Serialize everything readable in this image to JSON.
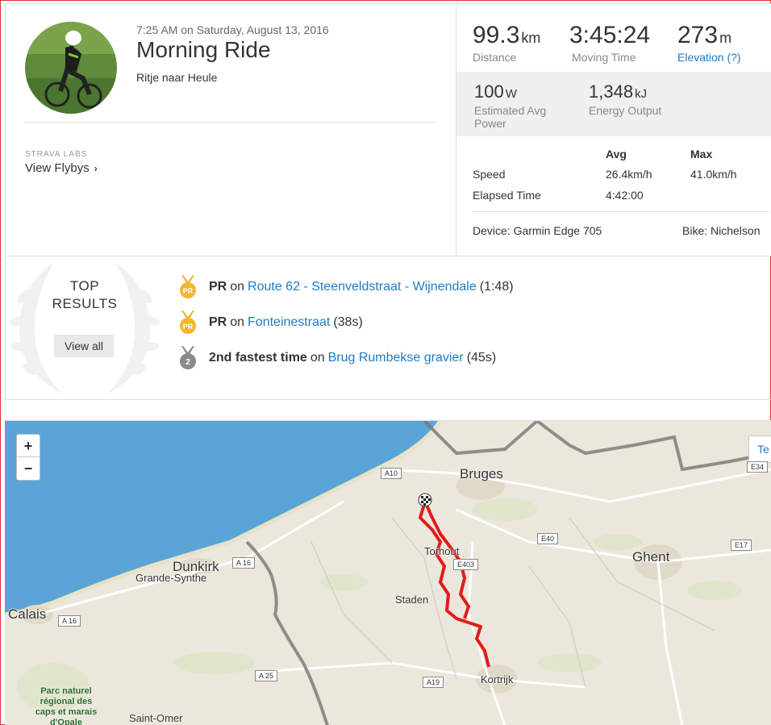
{
  "activity": {
    "timestamp": "7:25 AM on Saturday, August 13, 2016",
    "title": "Morning Ride",
    "description": "Ritje naar Heule"
  },
  "labs": {
    "label": "STRAVA LABS",
    "flybys": "View Flybys"
  },
  "stats": {
    "distance": {
      "value": "99.3",
      "unit": "km",
      "label": "Distance"
    },
    "moving_time": {
      "value": "3:45:24",
      "label": "Moving Time"
    },
    "elevation": {
      "value": "273",
      "unit": "m",
      "label": "Elevation (?)"
    },
    "power": {
      "value": "100",
      "unit": "W",
      "label": "Estimated Avg Power"
    },
    "energy": {
      "value": "1,348",
      "unit": "kJ",
      "label": "Energy Output"
    }
  },
  "table": {
    "headers": [
      "Avg",
      "Max"
    ],
    "rows": [
      {
        "label": "Speed",
        "avg": "26.4km/h",
        "max": "41.0km/h"
      },
      {
        "label": "Elapsed Time",
        "avg": "4:42:00",
        "max": ""
      }
    ]
  },
  "device": "Device: Garmin Edge 705",
  "bike": "Bike: Nichelson",
  "top_results": {
    "title_line1": "TOP",
    "title_line2": "RESULTS",
    "view_all": "View all",
    "items": [
      {
        "badge": "PR",
        "bold": "PR",
        "on": "on",
        "segment": "Route 62 - Steenveldstraat - Wijnendale",
        "time": "(1:48)",
        "medal_color": "#f2b632"
      },
      {
        "badge": "PR",
        "bold": "PR",
        "on": "on",
        "segment": "Fonteinestraat",
        "time": "(38s)",
        "medal_color": "#f2b632"
      },
      {
        "badge": "2",
        "bold": "2nd fastest time",
        "on": "on",
        "segment": "Brug Rumbekse gravier",
        "time": "(45s)",
        "medal_color": "#8a8a8a"
      }
    ]
  },
  "map": {
    "zoom_in": "+",
    "zoom_out": "−",
    "terrain": "Te",
    "labels": {
      "bruges": "Bruges",
      "ghent": "Ghent",
      "dunkirk": "Dunkirk",
      "grande_synthe": "Grande-Synthe",
      "calais": "Calais",
      "torhout": "Torhout",
      "staden": "Staden",
      "kortrijk": "Kortrijk",
      "saint_omer": "Saint-Omer",
      "park": "Parc naturel régional des caps et marais d'Opale"
    },
    "roads": [
      "A10",
      "E34",
      "E40",
      "E17",
      "A 16",
      "A 16",
      "E403",
      "A 25",
      "A19"
    ]
  },
  "colors": {
    "route": "#e31b1b",
    "link": "#1e7bc8",
    "sea": "#5aa5d6"
  }
}
